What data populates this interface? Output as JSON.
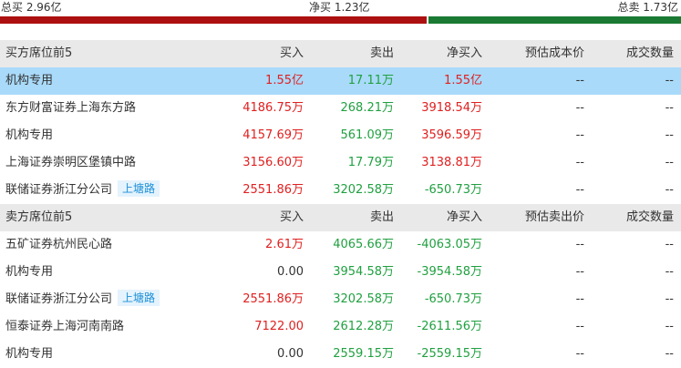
{
  "summary": {
    "total_buy": "总买 2.96亿",
    "net_buy": "净买 1.23亿",
    "total_sell": "总卖 1.73亿"
  },
  "buy_section": {
    "headers": {
      "name": "买方席位前5",
      "buy": "买入",
      "sell": "卖出",
      "net": "净买入",
      "est": "预估成本价",
      "vol": "成交数量"
    },
    "rows": [
      {
        "name": "机构专用",
        "tag": "",
        "buy": "1.55亿",
        "sell": "17.11万",
        "net": "1.55亿",
        "est": "--",
        "vol": "--"
      },
      {
        "name": "东方财富证券上海东方路",
        "tag": "",
        "buy": "4186.75万",
        "sell": "268.21万",
        "net": "3918.54万",
        "est": "--",
        "vol": "--"
      },
      {
        "name": "机构专用",
        "tag": "",
        "buy": "4157.69万",
        "sell": "561.09万",
        "net": "3596.59万",
        "est": "--",
        "vol": "--"
      },
      {
        "name": "上海证券崇明区堡镇中路",
        "tag": "",
        "buy": "3156.60万",
        "sell": "17.79万",
        "net": "3138.81万",
        "est": "--",
        "vol": "--"
      },
      {
        "name": "联储证券浙江分公司",
        "tag": "上塘路",
        "buy": "2551.86万",
        "sell": "3202.58万",
        "net": "-650.73万",
        "est": "--",
        "vol": "--"
      }
    ]
  },
  "sell_section": {
    "headers": {
      "name": "卖方席位前5",
      "buy": "买入",
      "sell": "卖出",
      "net": "净买入",
      "est": "预估卖出价",
      "vol": "成交数量"
    },
    "rows": [
      {
        "name": "五矿证券杭州民心路",
        "tag": "",
        "buy": "2.61万",
        "sell": "4065.66万",
        "net": "-4063.05万",
        "est": "--",
        "vol": "--"
      },
      {
        "name": "机构专用",
        "tag": "",
        "buy": "0.00",
        "sell": "3954.58万",
        "net": "-3954.58万",
        "est": "--",
        "vol": "--"
      },
      {
        "name": "联储证券浙江分公司",
        "tag": "上塘路",
        "buy": "2551.86万",
        "sell": "3202.58万",
        "net": "-650.73万",
        "est": "--",
        "vol": "--"
      },
      {
        "name": "恒泰证券上海河南南路",
        "tag": "",
        "buy": "7122.00",
        "sell": "2612.28万",
        "net": "-2611.56万",
        "est": "--",
        "vol": "--"
      },
      {
        "name": "机构专用",
        "tag": "",
        "buy": "0.00",
        "sell": "2559.15万",
        "net": "-2559.15万",
        "est": "--",
        "vol": "--"
      }
    ]
  },
  "colors": {
    "up": "#e02020",
    "down": "#20a040",
    "bar_buy": "#ad1010",
    "bar_sell": "#1a7a34",
    "highlight": "#a9dafa"
  }
}
